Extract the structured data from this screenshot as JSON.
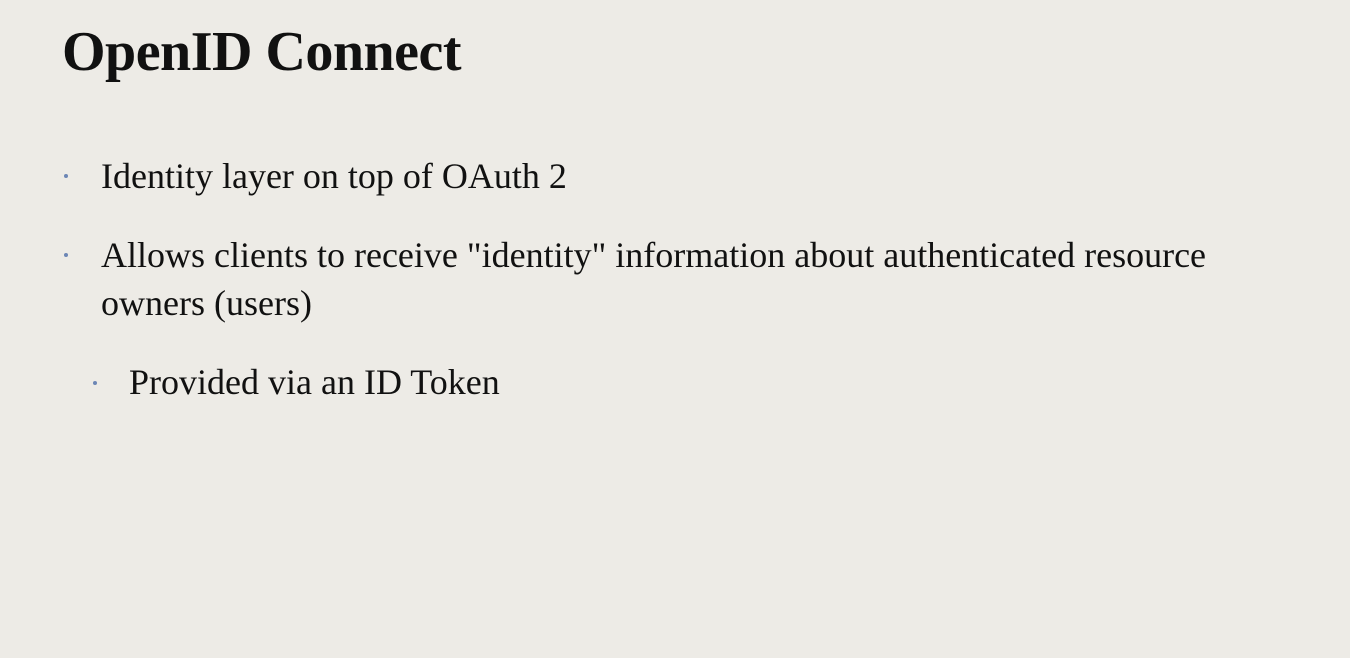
{
  "slide": {
    "title": "OpenID Connect",
    "bullets": [
      {
        "text": "Identity layer on top of OAuth 2",
        "level": 1
      },
      {
        "text": "Allows clients to receive \"identity\" information about authenticated resource owners (users)",
        "level": 1
      },
      {
        "text": "Provided via an ID Token",
        "level": 2
      }
    ]
  },
  "colors": {
    "background": "#edebe6",
    "text": "#111111",
    "bullet": "#6c86b5"
  }
}
